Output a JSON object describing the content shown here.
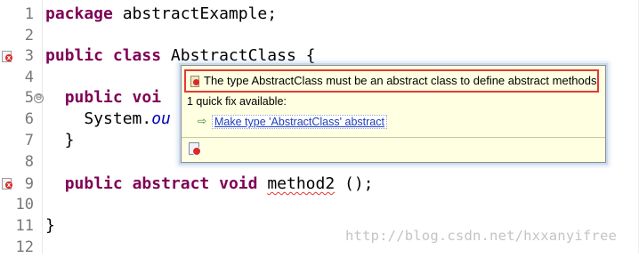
{
  "editor": {
    "line_numbers": [
      "1",
      "2",
      "3",
      "4",
      "5",
      "6",
      "7",
      "8",
      "9",
      "10",
      "11",
      "12"
    ],
    "fold_marker": "⊖",
    "lines": {
      "l1": {
        "kw": "package",
        "rest": " abstractExample;"
      },
      "l3": {
        "kw1": "public",
        "kw2": "class",
        "rest": " AbstractClass {"
      },
      "l5": {
        "kw1": "public",
        "rest": " voi"
      },
      "l6": {
        "pre": "    System.",
        "field": "ou"
      },
      "l7": {
        "text": "  }"
      },
      "l9": {
        "kw1": "public",
        "kw2": "abstract",
        "kw3": "void",
        "method": "method2",
        "rest": " ();"
      },
      "l11": {
        "text": "}"
      }
    }
  },
  "hover": {
    "problem": "The type AbstractClass must be an abstract class to define abstract methods",
    "fix_count": "1 quick fix available:",
    "fix_arrow": "⇨",
    "fix_label": "Make type 'AbstractClass' abstract"
  },
  "watermark": "http://blog.csdn.net/hxxanyifree",
  "colors": {
    "keyword": "#7f0055",
    "field": "#0000c0",
    "error": "#e53935",
    "hover_bg": "#ffffe1",
    "link": "#1f3fbf"
  },
  "icons": {
    "error_marker": "error-marker-icon",
    "problem": "error-icon",
    "fix": "quick-fix-arrow-icon",
    "toolbar": "quick-fix-tool-icon"
  }
}
